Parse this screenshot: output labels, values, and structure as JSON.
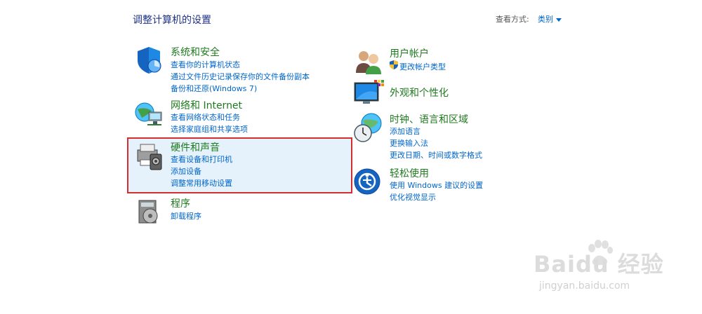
{
  "header": {
    "title": "调整计算机的设置",
    "view_by_label": "查看方式:",
    "view_by_value": "类别"
  },
  "categories": {
    "system": {
      "title": "系统和安全",
      "links": [
        "查看你的计算机状态",
        "通过文件历史记录保存你的文件备份副本",
        "备份和还原(Windows 7)"
      ],
      "icon": "shield-icon"
    },
    "network": {
      "title": "网络和 Internet",
      "links": [
        "查看网络状态和任务",
        "选择家庭组和共享选项"
      ],
      "icon": "globe-network-icon"
    },
    "hardware": {
      "title": "硬件和声音",
      "links": [
        "查看设备和打印机",
        "添加设备",
        "调整常用移动设置"
      ],
      "icon": "printer-icon"
    },
    "programs": {
      "title": "程序",
      "links": [
        "卸载程序"
      ],
      "icon": "programs-icon"
    },
    "users": {
      "title": "用户帐户",
      "links": [
        "更改帐户类型"
      ],
      "icon": "users-icon"
    },
    "appearance": {
      "title": "外观和个性化",
      "links": [],
      "icon": "monitor-icon"
    },
    "clock": {
      "title": "时钟、语言和区域",
      "links": [
        "添加语言",
        "更换输入法",
        "更改日期、时间或数字格式"
      ],
      "icon": "clock-globe-icon"
    },
    "ease": {
      "title": "轻松使用",
      "links": [
        "使用 Windows 建议的设置",
        "优化视觉显示"
      ],
      "icon": "ease-of-access-icon"
    }
  },
  "watermark": {
    "main": "Baidu 经验",
    "sub": "jingyan.baidu.com"
  },
  "colors": {
    "link": "#0066cc",
    "category_title": "#1f7a1f",
    "highlight_border": "#d32f2f",
    "highlight_bg": "#e5f1fb"
  }
}
